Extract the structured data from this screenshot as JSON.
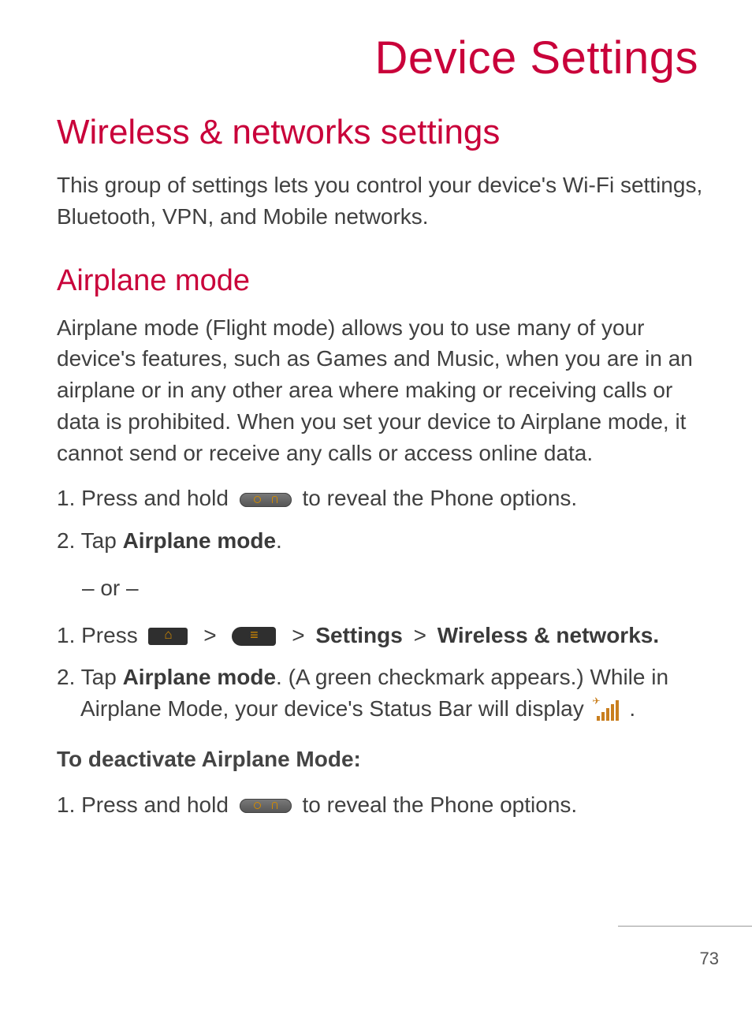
{
  "chapter_title": "Device Settings",
  "section_h1": "Wireless & networks settings",
  "intro": "This group of settings lets you control your device's Wi-Fi settings, Bluetooth, VPN, and Mobile networks.",
  "section_h2": "Airplane mode",
  "airplane_desc": "Airplane mode (Flight mode) allows you to use many of your device's features, such as Games and Music, when you are in an airplane or in any other area where making or receiving calls or data is prohibited. When you set your device to Airplane mode, it cannot send or receive any calls or access online data.",
  "a_step1_pre": "1. Press and hold ",
  "a_step1_post": " to reveal the Phone options.",
  "a_step2_pre": "2. Tap ",
  "a_step2_bold": "Airplane mode",
  "a_step2_post": ".",
  "or_text": "– or –",
  "b_step1_pre": "1. Press ",
  "sep1": " > ",
  "sep2": " > ",
  "settings_label": "Settings",
  "sep3": " > ",
  "wireless_label": "Wireless & networks.",
  "b_step2_pre": "2. Tap ",
  "b_step2_bold": "Airplane mode",
  "b_step2_mid": ". (A green checkmark appears.) While in",
  "b_step2_line2_pre": "Airplane Mode, your device's Status Bar will display ",
  "b_step2_line2_post": " .",
  "deactivate_heading": "To deactivate Airplane Mode:",
  "c_step1_pre": "1. Press and hold ",
  "c_step1_post": " to reveal the Phone options.",
  "page_number": "73"
}
